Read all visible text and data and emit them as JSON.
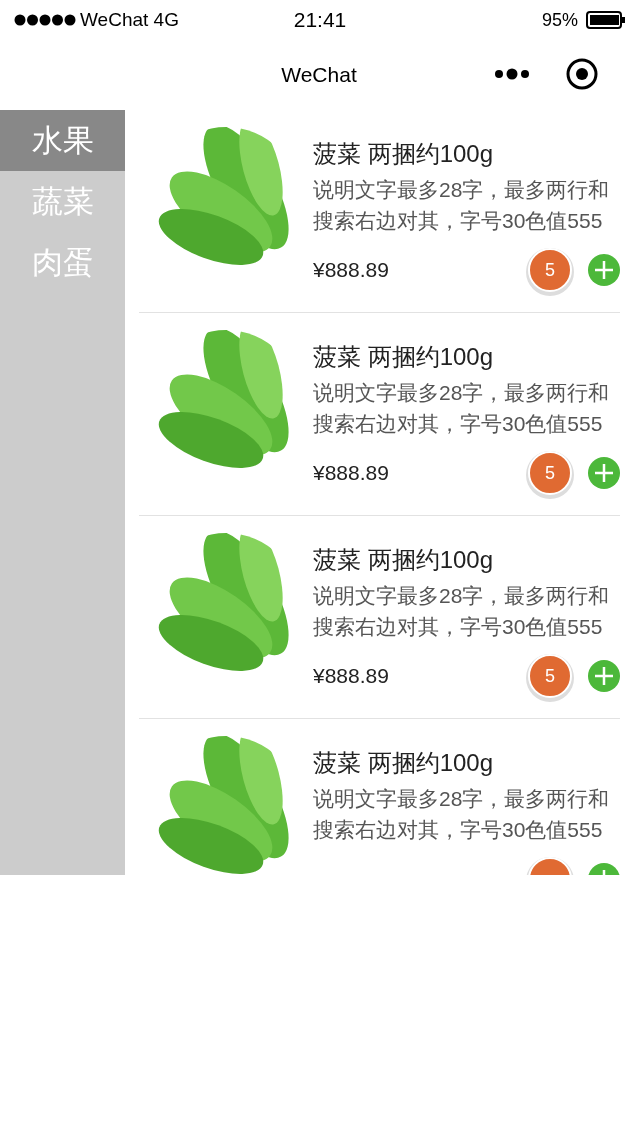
{
  "status_bar": {
    "carrier": "WeChat 4G",
    "time": "21:41",
    "battery": "95%"
  },
  "nav_bar": {
    "title": "WeChat"
  },
  "categories": [
    {
      "label": "水果",
      "selected": true
    },
    {
      "label": "蔬菜",
      "selected": false
    },
    {
      "label": "肉蛋",
      "selected": false
    }
  ],
  "products": [
    {
      "title": "菠菜 两捆约100g",
      "description": "说明文字最多28字，最多两行和搜索右边对其，字号30色值555",
      "price": "¥888.89",
      "count": "5"
    },
    {
      "title": "菠菜 两捆约100g",
      "description": "说明文字最多28字，最多两行和搜索右边对其，字号30色值555",
      "price": "¥888.89",
      "count": "5"
    },
    {
      "title": "菠菜 两捆约100g",
      "description": "说明文字最多28字，最多两行和搜索右边对其，字号30色值555",
      "price": "¥888.89",
      "count": "5"
    },
    {
      "title": "菠菜 两捆约100g",
      "description": "说明文字最多28字，最多两行和搜索右边对其，字号30色值555"
    }
  ]
}
